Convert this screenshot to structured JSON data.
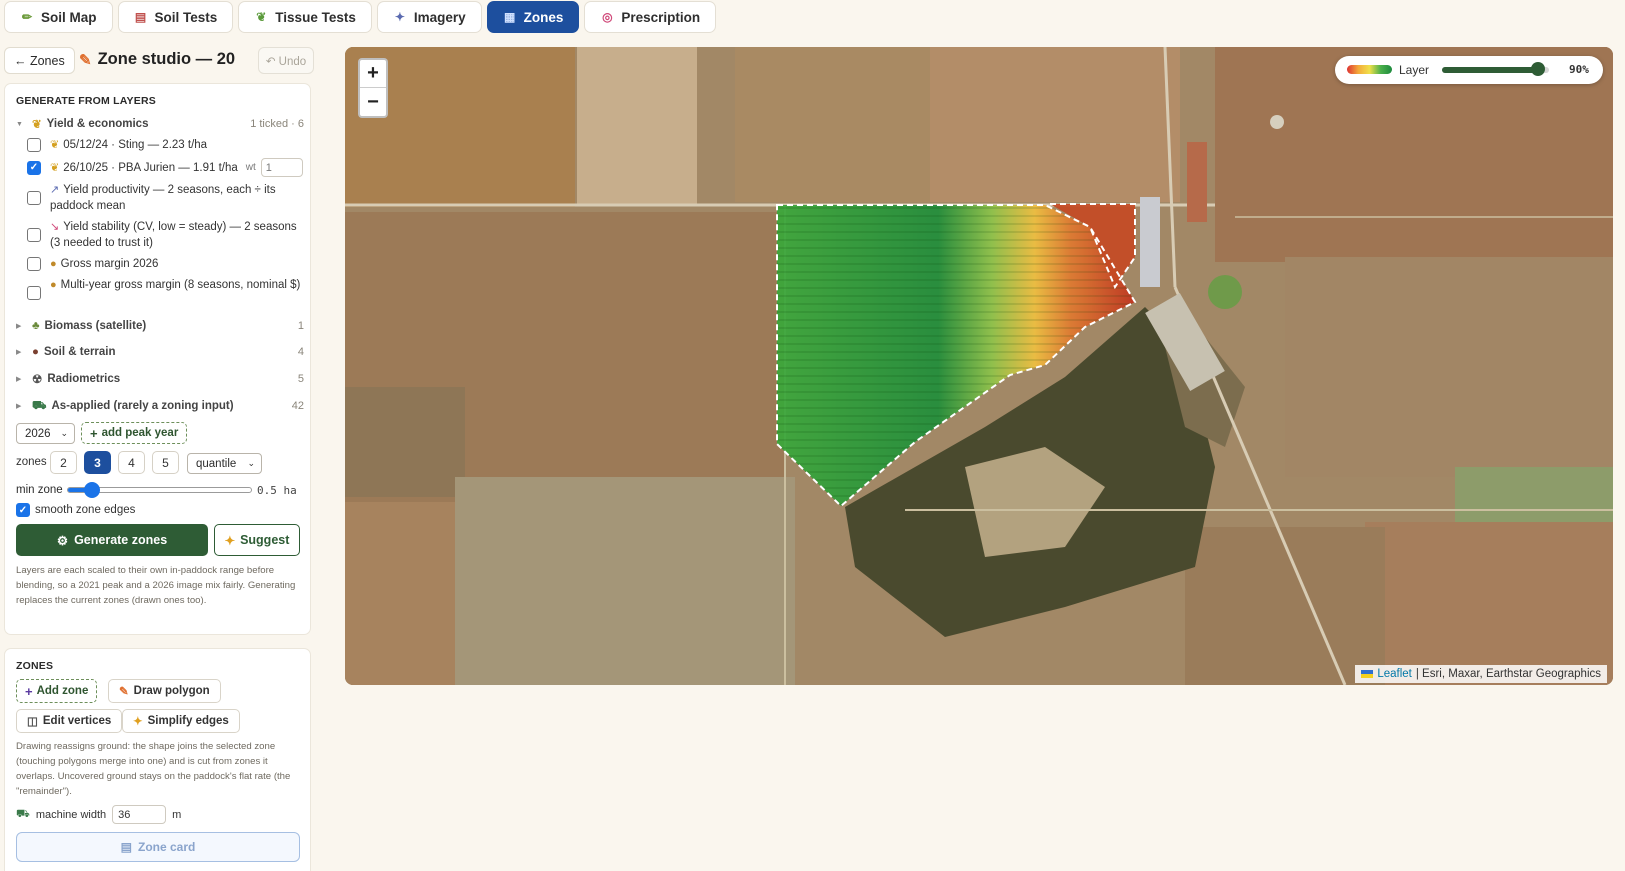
{
  "tabs": [
    {
      "label": "Soil Map",
      "icon": "✏",
      "icon_name": "pencil-icon"
    },
    {
      "label": "Soil Tests",
      "icon": "📋",
      "icon_name": "clipboard-icon"
    },
    {
      "label": "Tissue Tests",
      "icon": "🌿",
      "icon_name": "leaf-icon"
    },
    {
      "label": "Imagery",
      "icon": "🛰",
      "icon_name": "satellite-icon"
    },
    {
      "label": "Zones",
      "icon": "🗺",
      "icon_name": "map-icon"
    },
    {
      "label": "Prescription",
      "icon": "🎯",
      "icon_name": "target-icon"
    }
  ],
  "active_tab": "Zones",
  "studio": {
    "back_label": "← Zones",
    "title": "Zone studio — 20",
    "undo_label": "↶ Undo"
  },
  "generate": {
    "title": "GENERATE FROM LAYERS",
    "groups": [
      {
        "name": "Yield & economics",
        "icon": "🌾",
        "count": "1 ticked · 6",
        "expanded": true,
        "layers": [
          {
            "label": "05/12/24 · Sting — 2.23 t/ha",
            "icon": "🌾",
            "checked": false
          },
          {
            "label": "26/10/25 · PBA Jurien — 1.91 t/ha",
            "icon": "🌾",
            "checked": true,
            "weight": "1"
          },
          {
            "label": "Yield productivity — 2 seasons, each ÷ its paddock mean",
            "icon": "📈",
            "checked": false
          },
          {
            "label": "Yield stability (CV, low = steady) — 2 seasons (3 needed to trust it)",
            "icon": "📉",
            "checked": false
          },
          {
            "label": "Gross margin 2026",
            "icon": "💰",
            "checked": false
          },
          {
            "label": "Multi-year gross margin (8 seasons, nominal $)",
            "icon": "💰",
            "checked": false
          }
        ]
      },
      {
        "name": "Biomass (satellite)",
        "icon": "🌱",
        "count": "1",
        "expanded": false
      },
      {
        "name": "Soil & terrain",
        "icon": "🟤",
        "count": "4",
        "expanded": false
      },
      {
        "name": "Radiometrics",
        "icon": "☢",
        "count": "5",
        "expanded": false
      },
      {
        "name": "As-applied (rarely a zoning input)",
        "icon": "🚜",
        "count": "42",
        "expanded": false
      }
    ],
    "weight_label": "wt",
    "year_select": "2026",
    "add_peak_label": "add peak year",
    "zones_label": "zones",
    "zone_counts": [
      "2",
      "3",
      "4",
      "5"
    ],
    "selected_zones": "3",
    "method_select": "quantile",
    "min_zone_label": "min zone",
    "min_zone_value": "0.5 ha",
    "min_zone_fraction": 0.13,
    "smooth_label": "smooth zone edges",
    "smooth_checked": true,
    "generate_label": "Generate zones",
    "suggest_label": "Suggest",
    "note": "Layers are each scaled to their own in-paddock range before blending, so a 2021 peak and a 2026 image mix fairly. Generating replaces the current zones (drawn ones too)."
  },
  "zones_panel": {
    "title": "ZONES",
    "add_zone_label": "Add zone",
    "draw_polygon_label": "Draw polygon",
    "edit_vertices_label": "Edit vertices",
    "simplify_edges_label": "Simplify edges",
    "note": "Drawing reassigns ground: the shape joins the selected zone (touching polygons merge into one) and is cut from zones it overlaps. Uncovered ground stays on the paddock's flat rate (the \"remainder\").",
    "machine_width_label": "machine width",
    "machine_width_value": "36",
    "machine_width_unit": "m",
    "zone_card_label": "Zone card"
  },
  "map": {
    "zoom_in": "+",
    "zoom_out": "−",
    "layer_label": "Layer",
    "layer_opacity": "90%",
    "layer_opacity_fraction": 0.9,
    "attribution_link": "Leaflet",
    "attribution_text": "| Esri, Maxar, Earthstar Geographics"
  }
}
